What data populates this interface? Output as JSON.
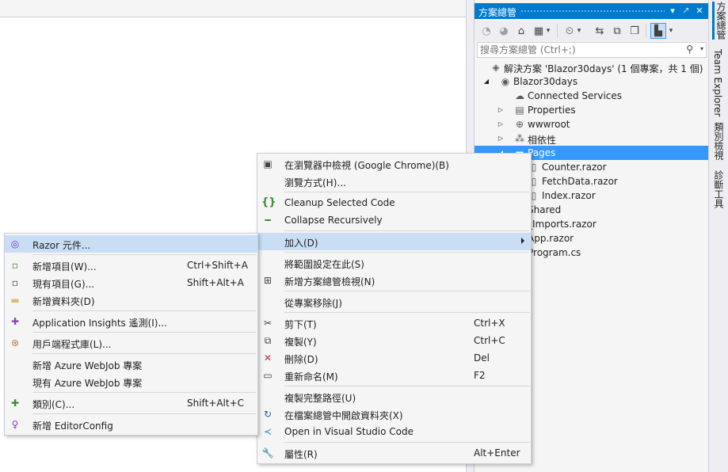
{
  "solution_explorer": {
    "title": "方案總管",
    "title_buttons": [
      "▾",
      "🡕",
      "✕"
    ],
    "toolbar": {
      "back": "◔",
      "forward": "◕",
      "home": "⌂",
      "switch_views": "▦",
      "switch_views_drop": "▾",
      "pending_changes": "⏲",
      "pending_changes_drop": "▾",
      "sync": "⇆",
      "collapse_all": "⧉",
      "show_all": "❐",
      "preview": "▙",
      "preview_drop": "▾"
    },
    "search": {
      "placeholder": "搜尋方案總管 (Ctrl+;)",
      "icon": "⚲",
      "drop": "▾"
    },
    "tree": [
      {
        "label": "解決方案 'Blazor30days' (1 個專案，共 1 個)",
        "icon": "◈",
        "arrow": "",
        "selected": false
      },
      {
        "label": "Blazor30days",
        "icon": "◉",
        "arrow": "◢",
        "selected": false
      },
      {
        "label": "Connected Services",
        "icon": "☁",
        "arrow": "",
        "selected": false
      },
      {
        "label": "Properties",
        "icon": "▤",
        "arrow": "▷",
        "selected": false
      },
      {
        "label": "wwwroot",
        "icon": "⊕",
        "arrow": "▷",
        "selected": false
      },
      {
        "label": "相依性",
        "icon": "⁂",
        "arrow": "▷",
        "selected": false
      },
      {
        "label": "Pages",
        "icon": "▬",
        "arrow": "◢",
        "selected": true
      },
      {
        "label": "Counter.razor",
        "icon": "▯",
        "arrow": "",
        "selected": false
      },
      {
        "label": "FetchData.razor",
        "icon": "▯",
        "arrow": "",
        "selected": false
      },
      {
        "label": "Index.razor",
        "icon": "▯",
        "arrow": "",
        "selected": false
      },
      {
        "label": "Shared",
        "icon": "",
        "arrow": "",
        "selected": false
      },
      {
        "label": "_Imports.razor",
        "icon": "",
        "arrow": "",
        "selected": false
      },
      {
        "label": "App.razor",
        "icon": "",
        "arrow": "",
        "selected": false
      },
      {
        "label": "Program.cs",
        "icon": "",
        "arrow": "",
        "selected": false
      }
    ]
  },
  "side_tabs": [
    "方案總管",
    "Team Explorer",
    "類別檢視",
    "診斷工具"
  ],
  "context_menu": {
    "items": [
      {
        "label": "在瀏覽器中檢視 (Google Chrome)(B)",
        "shortcut": "",
        "icon": "▣",
        "icon_color": "#424242"
      },
      {
        "label": "瀏覽方式(H)...",
        "shortcut": "",
        "icon": "",
        "icon_color": "#424242"
      },
      {
        "label": "Cleanup Selected Code",
        "shortcut": "",
        "icon": "{}",
        "icon_color": "#388a34"
      },
      {
        "label": "Collapse Recursively",
        "shortcut": "",
        "icon": "━",
        "icon_color": "#388a34"
      },
      {
        "label": "加入(D)",
        "shortcut": "",
        "icon": "",
        "icon_color": "#424242"
      },
      {
        "label": "將範圍設定在此(S)",
        "shortcut": "",
        "icon": "",
        "icon_color": "#424242"
      },
      {
        "label": "新增方案總管檢視(N)",
        "shortcut": "",
        "icon": "⊞",
        "icon_color": "#424242"
      },
      {
        "label": "從專案移除(J)",
        "shortcut": "",
        "icon": "",
        "icon_color": "#424242"
      },
      {
        "label": "剪下(T)",
        "shortcut": "Ctrl+X",
        "icon": "✂",
        "icon_color": "#424242"
      },
      {
        "label": "複製(Y)",
        "shortcut": "Ctrl+C",
        "icon": "⧉",
        "icon_color": "#424242"
      },
      {
        "label": "刪除(D)",
        "shortcut": "Del",
        "icon": "✕",
        "icon_color": "#c5283d"
      },
      {
        "label": "重新命名(M)",
        "shortcut": "F2",
        "icon": "▭",
        "icon_color": "#424242"
      },
      {
        "label": "複製完整路徑(U)",
        "shortcut": "",
        "icon": "",
        "icon_color": "#424242"
      },
      {
        "label": "在檔案總管中開啟資料夾(X)",
        "shortcut": "",
        "icon": "↻",
        "icon_color": "#1e5a9c"
      },
      {
        "label": "Open in Visual Studio Code",
        "shortcut": "",
        "icon": "≺",
        "icon_color": "#1e82d6"
      },
      {
        "label": "屬性(R)",
        "shortcut": "Alt+Enter",
        "icon": "🔧",
        "icon_color": "#424242"
      }
    ]
  },
  "add_submenu": {
    "items": [
      {
        "label": "Razor 元件...",
        "shortcut": "",
        "icon": "◎",
        "icon_color": "#6a3fb5"
      },
      {
        "label": "新增項目(W)...",
        "shortcut": "Ctrl+Shift+A",
        "icon": "▫",
        "icon_color": "#388a34"
      },
      {
        "label": "現有項目(G)...",
        "shortcut": "Shift+Alt+A",
        "icon": "▫",
        "icon_color": "#424242"
      },
      {
        "label": "新增資料夾(D)",
        "shortcut": "",
        "icon": "▬",
        "icon_color": "#dcb67a"
      },
      {
        "label": "Application Insights 遙測(I)...",
        "shortcut": "",
        "icon": "✚",
        "icon_color": "#8a3fb5"
      },
      {
        "label": "用戶端程式庫(L)...",
        "shortcut": "",
        "icon": "⊛",
        "icon_color": "#c56a3b"
      },
      {
        "label": "新增 Azure WebJob 專案",
        "shortcut": "",
        "icon": "",
        "icon_color": "#424242"
      },
      {
        "label": "現有 Azure WebJob 專案",
        "shortcut": "",
        "icon": "",
        "icon_color": "#424242"
      },
      {
        "label": "類別(C)...",
        "shortcut": "Shift+Alt+C",
        "icon": "✚",
        "icon_color": "#388a34"
      },
      {
        "label": "新增 EditorConfig",
        "shortcut": "",
        "icon": "♀",
        "icon_color": "#8a3fb5"
      }
    ]
  },
  "colors": {
    "accent": "#007acc",
    "selection": "#3399ff",
    "menu_highlight": "#c9def5"
  }
}
